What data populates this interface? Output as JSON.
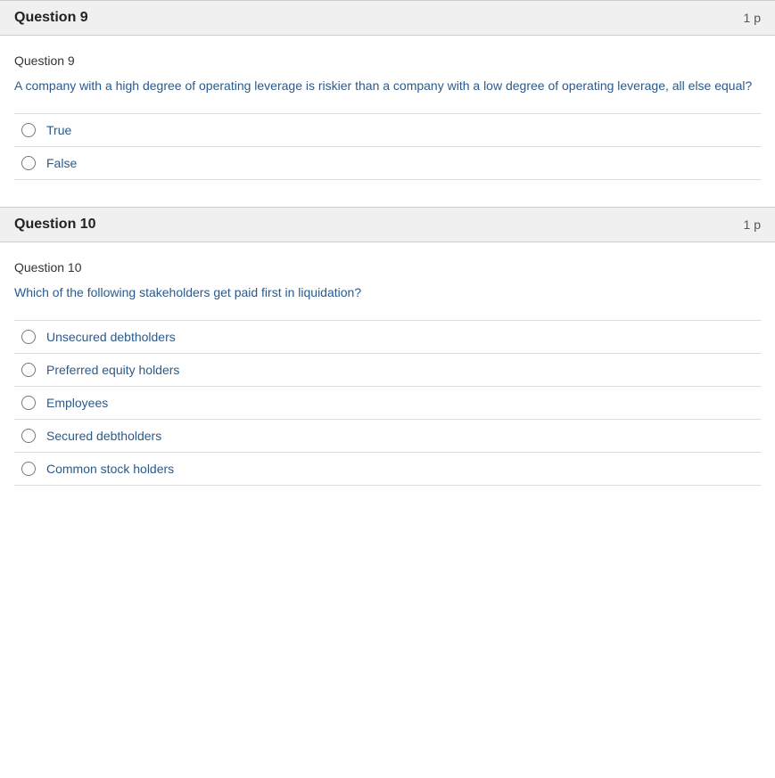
{
  "question9": {
    "header_title": "Question 9",
    "points": "1 p",
    "label": "Question 9",
    "text": "A company with a high degree of operating leverage is riskier than a company with a low degree of operating leverage, all else equal?",
    "options": [
      {
        "id": "q9_true",
        "label": "True"
      },
      {
        "id": "q9_false",
        "label": "False"
      }
    ]
  },
  "question10": {
    "header_title": "Question 10",
    "points": "1 p",
    "label": "Question 10",
    "text": "Which of the following stakeholders get paid first in liquidation?",
    "options": [
      {
        "id": "q10_a",
        "label": "Unsecured debtholders"
      },
      {
        "id": "q10_b",
        "label": "Preferred equity holders"
      },
      {
        "id": "q10_c",
        "label": "Employees"
      },
      {
        "id": "q10_d",
        "label": "Secured debtholders"
      },
      {
        "id": "q10_e",
        "label": "Common stock holders"
      }
    ]
  }
}
